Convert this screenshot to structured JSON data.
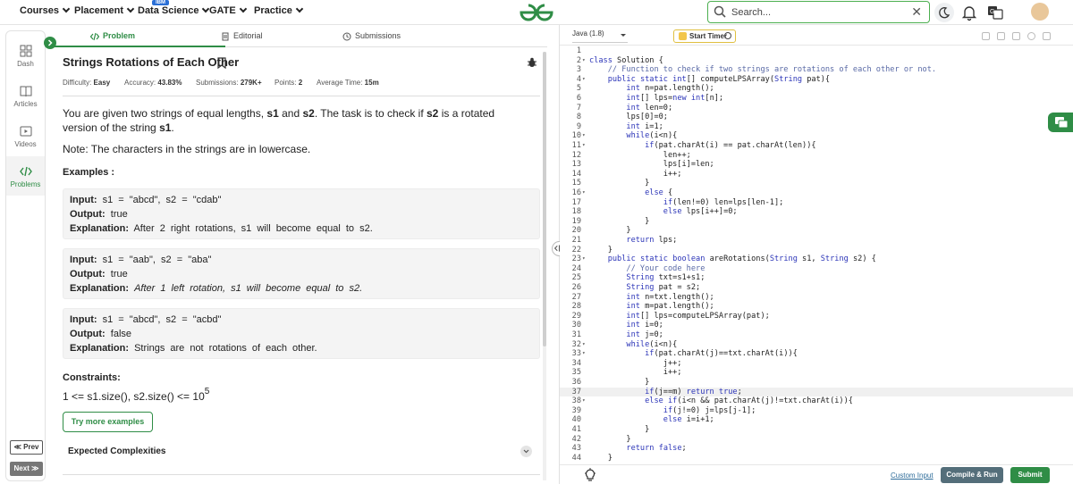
{
  "nav": {
    "items": [
      {
        "label": "Courses"
      },
      {
        "label": "Placement"
      },
      {
        "label": "Data Science"
      },
      {
        "label": "GATE"
      },
      {
        "label": "Practice"
      }
    ],
    "ibm_badge": "IBM",
    "search_placeholder": "Search..."
  },
  "rail": {
    "items": [
      {
        "label": "Dash",
        "icon": "dashboard-icon"
      },
      {
        "label": "Articles",
        "icon": "book-icon"
      },
      {
        "label": "Videos",
        "icon": "video-icon"
      },
      {
        "label": "Problems",
        "icon": "code-icon"
      }
    ],
    "prev": "≪ Prev",
    "next": "Next ≫"
  },
  "tabs": {
    "problem": "Problem",
    "editorial": "Editorial",
    "submissions": "Submissions"
  },
  "problem": {
    "title": "Strings Rotations of Each Other",
    "meta": {
      "difficulty_label": "Difficulty:",
      "difficulty": "Easy",
      "accuracy_label": "Accuracy:",
      "accuracy": "43.83%",
      "submissions_label": "Submissions:",
      "submissions": "279K+",
      "points_label": "Points:",
      "points": "2",
      "avg_time_label": "Average Time:",
      "avg_time": "15m"
    },
    "statement": {
      "p1": "You are given two strings of equal lengths,",
      "s1": "s1",
      "and": "and",
      "s2": "s2",
      "p2": ". The task is to check if",
      "p3": "is a rotated version of the string",
      "end": "."
    },
    "note": "Note: The characters in the strings are in lowercase.",
    "examples_heading": "Examples :",
    "labels": {
      "input": "Input:",
      "output": "Output:",
      "explanation": "Explanation:"
    },
    "examples": [
      {
        "input": "s1 = \"abcd\", s2 = \"cdab\"",
        "output": "true",
        "explanation": "After 2 right rotations, s1 will become equal to s2."
      },
      {
        "input": "s1 = \"aab\", s2 = \"aba\"",
        "output": "true",
        "explanation": "After 1 left rotation, s1 will become equal to s2."
      },
      {
        "input": "s1 = \"abcd\", s2 = \"acbd\"",
        "output": "false",
        "explanation": "Strings are not rotations of each other."
      }
    ],
    "constraints_heading": "Constraints:",
    "constraint_text": "1 <= s1.size(), s2.size() <= 10",
    "constraint_exp": "5",
    "try_more": "Try more examples",
    "expected_complexities": "Expected Complexities"
  },
  "editor": {
    "language": "Java (1.8)",
    "timer": "Start Timer",
    "active_line": 37,
    "lines": [
      {
        "n": "1",
        "f": "",
        "code": ""
      },
      {
        "n": "2",
        "f": "▾",
        "code": "class Solution {"
      },
      {
        "n": "3",
        "f": "",
        "code": "    // Function to check if two strings are rotations of each other or not."
      },
      {
        "n": "4",
        "f": "▾",
        "code": "    public static int[] computeLPSArray(String pat){"
      },
      {
        "n": "5",
        "f": "",
        "code": "        int n=pat.length();"
      },
      {
        "n": "6",
        "f": "",
        "code": "        int[] lps=new int[n];"
      },
      {
        "n": "7",
        "f": "",
        "code": "        int len=0;"
      },
      {
        "n": "8",
        "f": "",
        "code": "        lps[0]=0;"
      },
      {
        "n": "9",
        "f": "",
        "code": "        int i=1;"
      },
      {
        "n": "10",
        "f": "▾",
        "code": "        while(i<n){"
      },
      {
        "n": "11",
        "f": "▾",
        "code": "            if(pat.charAt(i) == pat.charAt(len)){"
      },
      {
        "n": "12",
        "f": "",
        "code": "                len++;"
      },
      {
        "n": "13",
        "f": "",
        "code": "                lps[i]=len;"
      },
      {
        "n": "14",
        "f": "",
        "code": "                i++;"
      },
      {
        "n": "15",
        "f": "",
        "code": "            }"
      },
      {
        "n": "16",
        "f": "▾",
        "code": "            else {"
      },
      {
        "n": "17",
        "f": "",
        "code": "                if(len!=0) len=lps[len-1];"
      },
      {
        "n": "18",
        "f": "",
        "code": "                else lps[i++]=0;"
      },
      {
        "n": "19",
        "f": "",
        "code": "            }"
      },
      {
        "n": "20",
        "f": "",
        "code": "        }"
      },
      {
        "n": "21",
        "f": "",
        "code": "        return lps;"
      },
      {
        "n": "22",
        "f": "",
        "code": "    }"
      },
      {
        "n": "23",
        "f": "▾",
        "code": "    public static boolean areRotations(String s1, String s2) {"
      },
      {
        "n": "24",
        "f": "",
        "code": "        // Your code here"
      },
      {
        "n": "25",
        "f": "",
        "code": "        String txt=s1+s1;"
      },
      {
        "n": "26",
        "f": "",
        "code": "        String pat = s2;"
      },
      {
        "n": "27",
        "f": "",
        "code": "        int n=txt.length();"
      },
      {
        "n": "28",
        "f": "",
        "code": "        int m=pat.length();"
      },
      {
        "n": "29",
        "f": "",
        "code": "        int[] lps=computeLPSArray(pat);"
      },
      {
        "n": "30",
        "f": "",
        "code": "        int i=0;"
      },
      {
        "n": "31",
        "f": "",
        "code": "        int j=0;"
      },
      {
        "n": "32",
        "f": "▾",
        "code": "        while(i<n){"
      },
      {
        "n": "33",
        "f": "▾",
        "code": "            if(pat.charAt(j)==txt.charAt(i)){"
      },
      {
        "n": "34",
        "f": "",
        "code": "                j++;"
      },
      {
        "n": "35",
        "f": "",
        "code": "                i++;"
      },
      {
        "n": "36",
        "f": "",
        "code": "            }"
      },
      {
        "n": "37",
        "f": "",
        "code": "            if(j==m) return true;"
      },
      {
        "n": "38",
        "f": "▾",
        "code": "            else if(i<n && pat.charAt(j)!=txt.charAt(i)){"
      },
      {
        "n": "39",
        "f": "",
        "code": "                if(j!=0) j=lps[j-1];"
      },
      {
        "n": "40",
        "f": "",
        "code": "                else i=i+1;"
      },
      {
        "n": "41",
        "f": "",
        "code": "            }"
      },
      {
        "n": "42",
        "f": "",
        "code": "        }"
      },
      {
        "n": "43",
        "f": "",
        "code": "        return false;"
      },
      {
        "n": "44",
        "f": "",
        "code": "    }"
      }
    ],
    "custom_input": "Custom Input",
    "compile_run": "Compile & Run",
    "submit": "Submit"
  },
  "colors": {
    "brand_green": "#2f8d46",
    "keyword_blue": "#2c35b8",
    "comment": "#5a6aa6",
    "compile_btn": "#546e7a"
  }
}
